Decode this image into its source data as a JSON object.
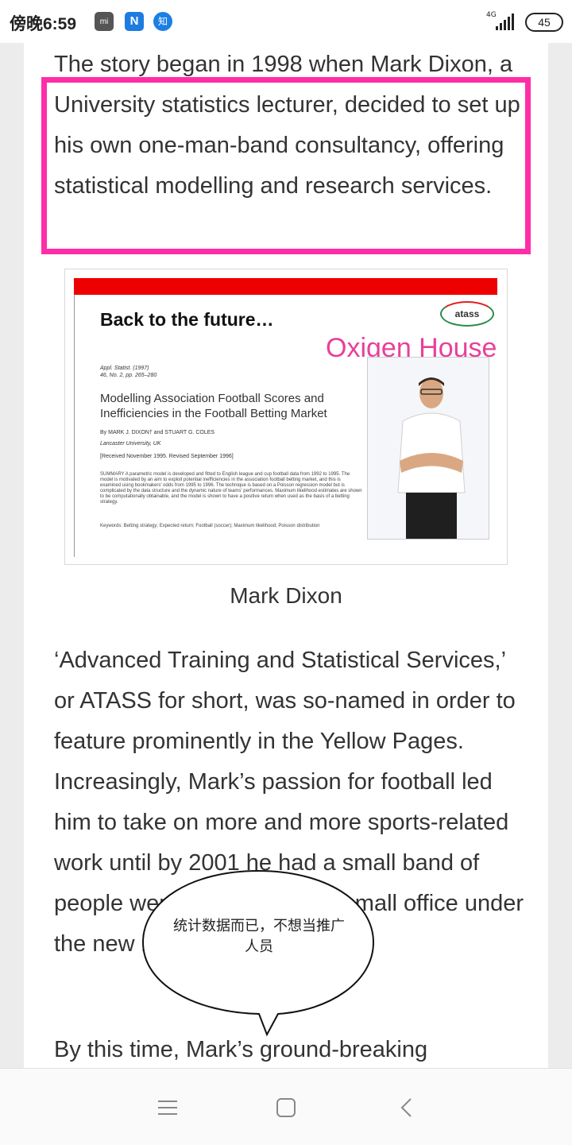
{
  "status_bar": {
    "time": "傍晚6:59",
    "icons": [
      "mi-icon",
      "n-app-icon",
      "zhihu-icon"
    ],
    "icon_labels": {
      "mi": "mi",
      "n": "N",
      "zhi": "知"
    },
    "network": "4G",
    "battery": "45"
  },
  "article": {
    "paragraph1": "The story began in 1998 when Mark Dixon, a University statistics lecturer, decided to set up his own one-man-band consultancy, offering statistical modelling and research services.",
    "figure": {
      "heading": "Back to the future…",
      "logo": "atass",
      "watermark": "Oxigen House",
      "citation_journal": "Appl. Statist. (1997)",
      "citation_volume": "46, No. 2, pp. 265–280",
      "paper_title": "Modelling Association Football Scores and Inefficiencies in the Football Betting Market",
      "authors": "By MARK J. DIXON† and STUART G. COLES",
      "affiliation": "Lancaster University, UK",
      "received": "[Received November 1995. Revised September 1996]",
      "summary": "SUMMARY A parametric model is developed and fitted to English league and cup football data from 1992 to 1995. The model is motivated by an aim to exploit potential inefficiencies in the association football betting market, and this is examined using bookmakers' odds from 1995 to 1996. The technique is based on a Poisson regression model but is complicated by the data structure and the dynamic nature of teams' performances. Maximum likelihood estimates are shown to be computationally obtainable, and the model is shown to have a positive return when used as the basis of a betting strategy.",
      "keywords": "Keywords: Betting strategy; Expected return; Football (soccer); Maximum likelihood; Poisson distribution"
    },
    "caption": "Mark Dixon",
    "paragraph2": "‘Advanced Training and Statistical Services,’ or ATASS for short, was so-named in order to feature prominently in the Yellow Pages. Increasingly, Mark’s passion for football led him to take on more and more sports-related work until by 2001 he had a small band of people were working from a small office under the new label of ATASS Sports.",
    "paragraph3": "By this time, Mark’s ground-breaking"
  },
  "bubble": {
    "text": "统计数据而已，不想当推广人员"
  },
  "navbar": {
    "items": [
      "menu-icon",
      "home-icon",
      "back-icon"
    ]
  },
  "colors": {
    "highlight": "#ff2da8",
    "figure_bar": "#ee0000",
    "watermark": "#e8409a"
  }
}
